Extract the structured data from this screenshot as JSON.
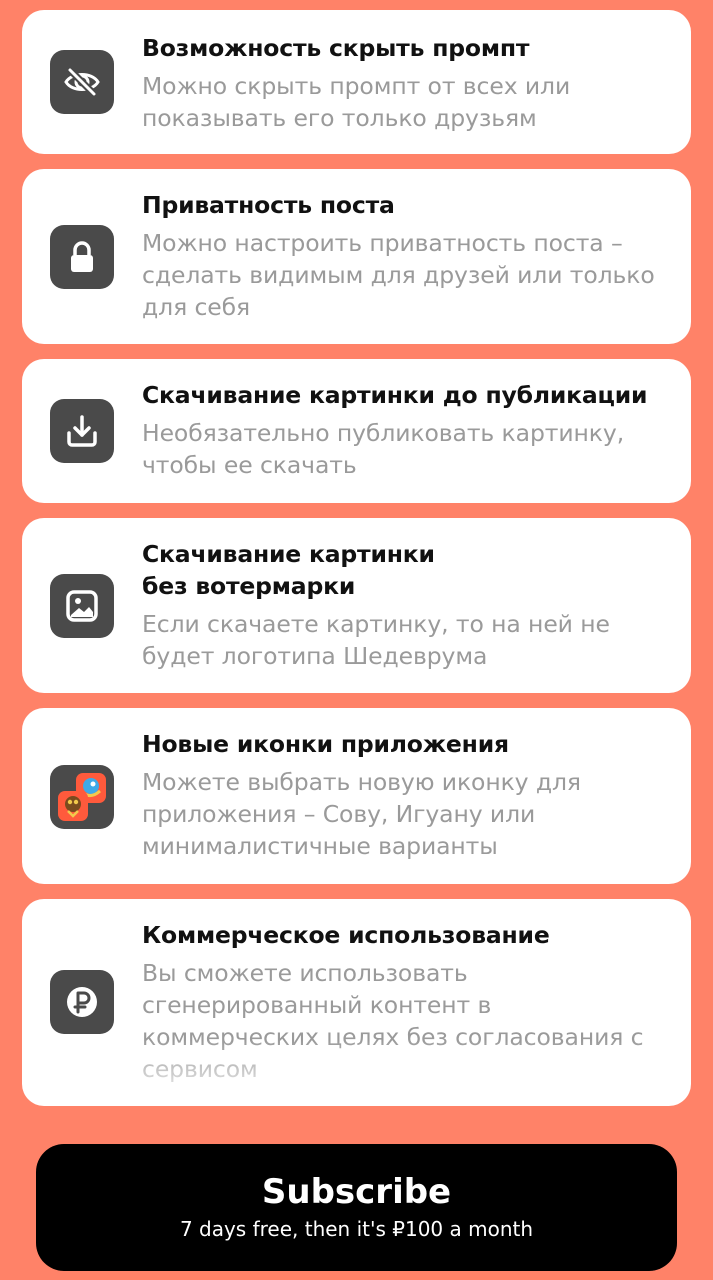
{
  "features": [
    {
      "title": "Возможность скрыть промпт",
      "description": "Можно скрыть промпт от всех или показывать его только друзьям",
      "icon": "eye-off-icon"
    },
    {
      "title": "Приватность поста",
      "description": "Можно настроить приватность поста – сделать видимым для друзей или только для себя",
      "icon": "lock-icon"
    },
    {
      "title": "Скачивание картинки до публикации",
      "description": "Необязательно публиковать картинку, чтобы ее скачать",
      "icon": "download-icon"
    },
    {
      "title": "Скачивание картинки\nбез вотермарки",
      "description": "Если скачаете картинку, то на ней не будет логотипа Шедеврума",
      "icon": "image-icon"
    },
    {
      "title": "Новые иконки приложения",
      "description": "Можете выбрать новую иконку для приложения – Сову, Игуану или минималистичные варианты",
      "icon": "app-icons-icon"
    },
    {
      "title": "Коммерческое использование",
      "description": "Вы сможете использовать сгенерированный контент в коммерческих целях без согласования с сервисом",
      "icon": "ruble-icon"
    }
  ],
  "subscribe": {
    "label": "Subscribe",
    "sublabel": "7 days free, then it's ₽100 a month"
  },
  "colors": {
    "background": "#FF8268",
    "card": "#FFFFFF",
    "icon_bg": "#4A4A4A",
    "title": "#111111",
    "description": "#9A9A9A",
    "button": "#000000"
  }
}
